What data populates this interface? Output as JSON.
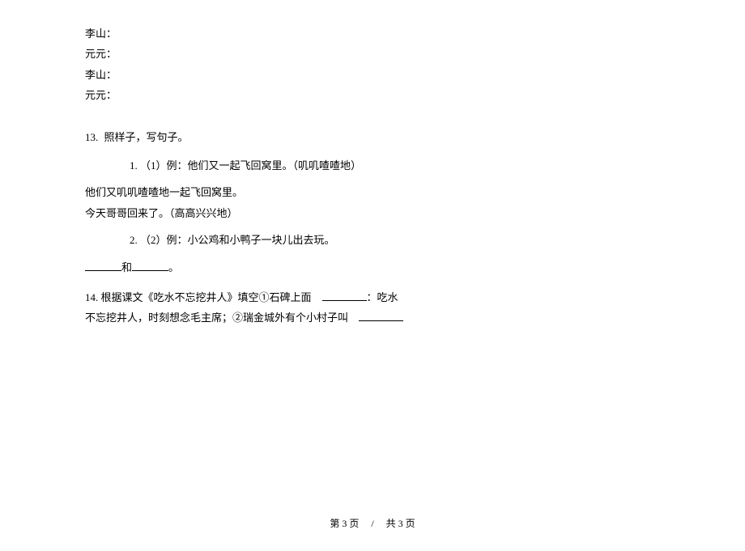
{
  "names": {
    "n1": "李山：",
    "n2": "元元：",
    "n3": "李山：",
    "n4": "元元："
  },
  "q13": {
    "num": "13.",
    "title": "照样子，写句子。",
    "sub1": {
      "num": "1.",
      "label": "（1）例：他们又一起飞回窝里。（叽叽喳喳地）"
    },
    "line1": "他们又叽叽喳喳地一起飞回窝里。",
    "line2": "今天哥哥回来了。（高高兴兴地）",
    "sub2": {
      "num": "2.",
      "label": "（2）例：小公鸡和小鸭子一块儿出去玩。"
    },
    "fill_and": "和",
    "fill_end": "。"
  },
  "q14": {
    "num": "14.",
    "part1": "根据课文《吃水不忘挖井人》填空①石碑上面",
    "part2": "：吃水",
    "part3": "不忘挖井人，时刻想念毛主席；②瑞金城外有个小村子叫"
  },
  "footer": {
    "left": "第 3 页",
    "sep": "/",
    "right": "共 3 页"
  }
}
